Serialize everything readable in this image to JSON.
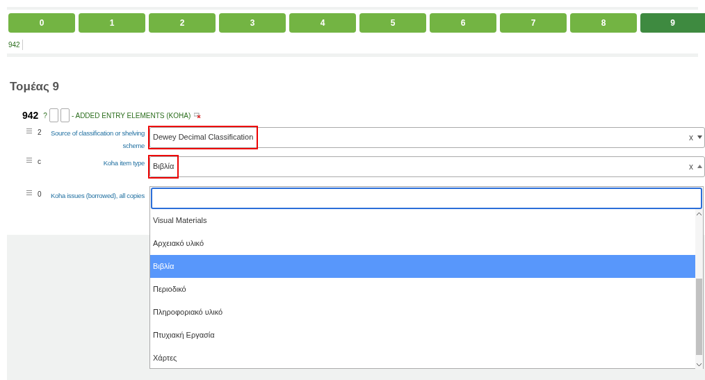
{
  "tabs": [
    {
      "label": "0",
      "selected": false
    },
    {
      "label": "1",
      "selected": false
    },
    {
      "label": "2",
      "selected": false
    },
    {
      "label": "3",
      "selected": false
    },
    {
      "label": "4",
      "selected": false
    },
    {
      "label": "5",
      "selected": false
    },
    {
      "label": "6",
      "selected": false
    },
    {
      "label": "7",
      "selected": false
    },
    {
      "label": "8",
      "selected": false
    },
    {
      "label": "9",
      "selected": true
    }
  ],
  "tag_links": [
    "942"
  ],
  "section_title": "Τομέας 9",
  "field": {
    "tag": "942",
    "help": "?",
    "title": "- ADDED ENTRY ELEMENTS (KOHA)"
  },
  "subfields": [
    {
      "code": "2",
      "label": "Source of classification or shelving scheme",
      "kind": "select",
      "value": "Dewey Decimal Classification",
      "highlighted": true,
      "expanded": false,
      "clear": "x"
    },
    {
      "code": "c",
      "label": "Koha item type",
      "kind": "select",
      "value": "Βιβλία",
      "highlighted": true,
      "expanded": true,
      "clear": "x"
    },
    {
      "code": "0",
      "label": "Koha issues (borrowed), all copies",
      "kind": "text"
    }
  ],
  "dropdown": {
    "options": [
      {
        "label": "Visual Materials",
        "selected": false
      },
      {
        "label": "Αρχειακό υλικό",
        "selected": false
      },
      {
        "label": "Βιβλία",
        "selected": true
      },
      {
        "label": "Περιοδικό",
        "selected": false
      },
      {
        "label": "Πληροφοριακό υλικό",
        "selected": false
      },
      {
        "label": "Πτυχιακή Εργασία",
        "selected": false
      },
      {
        "label": "Χάρτες",
        "selected": false
      }
    ]
  }
}
